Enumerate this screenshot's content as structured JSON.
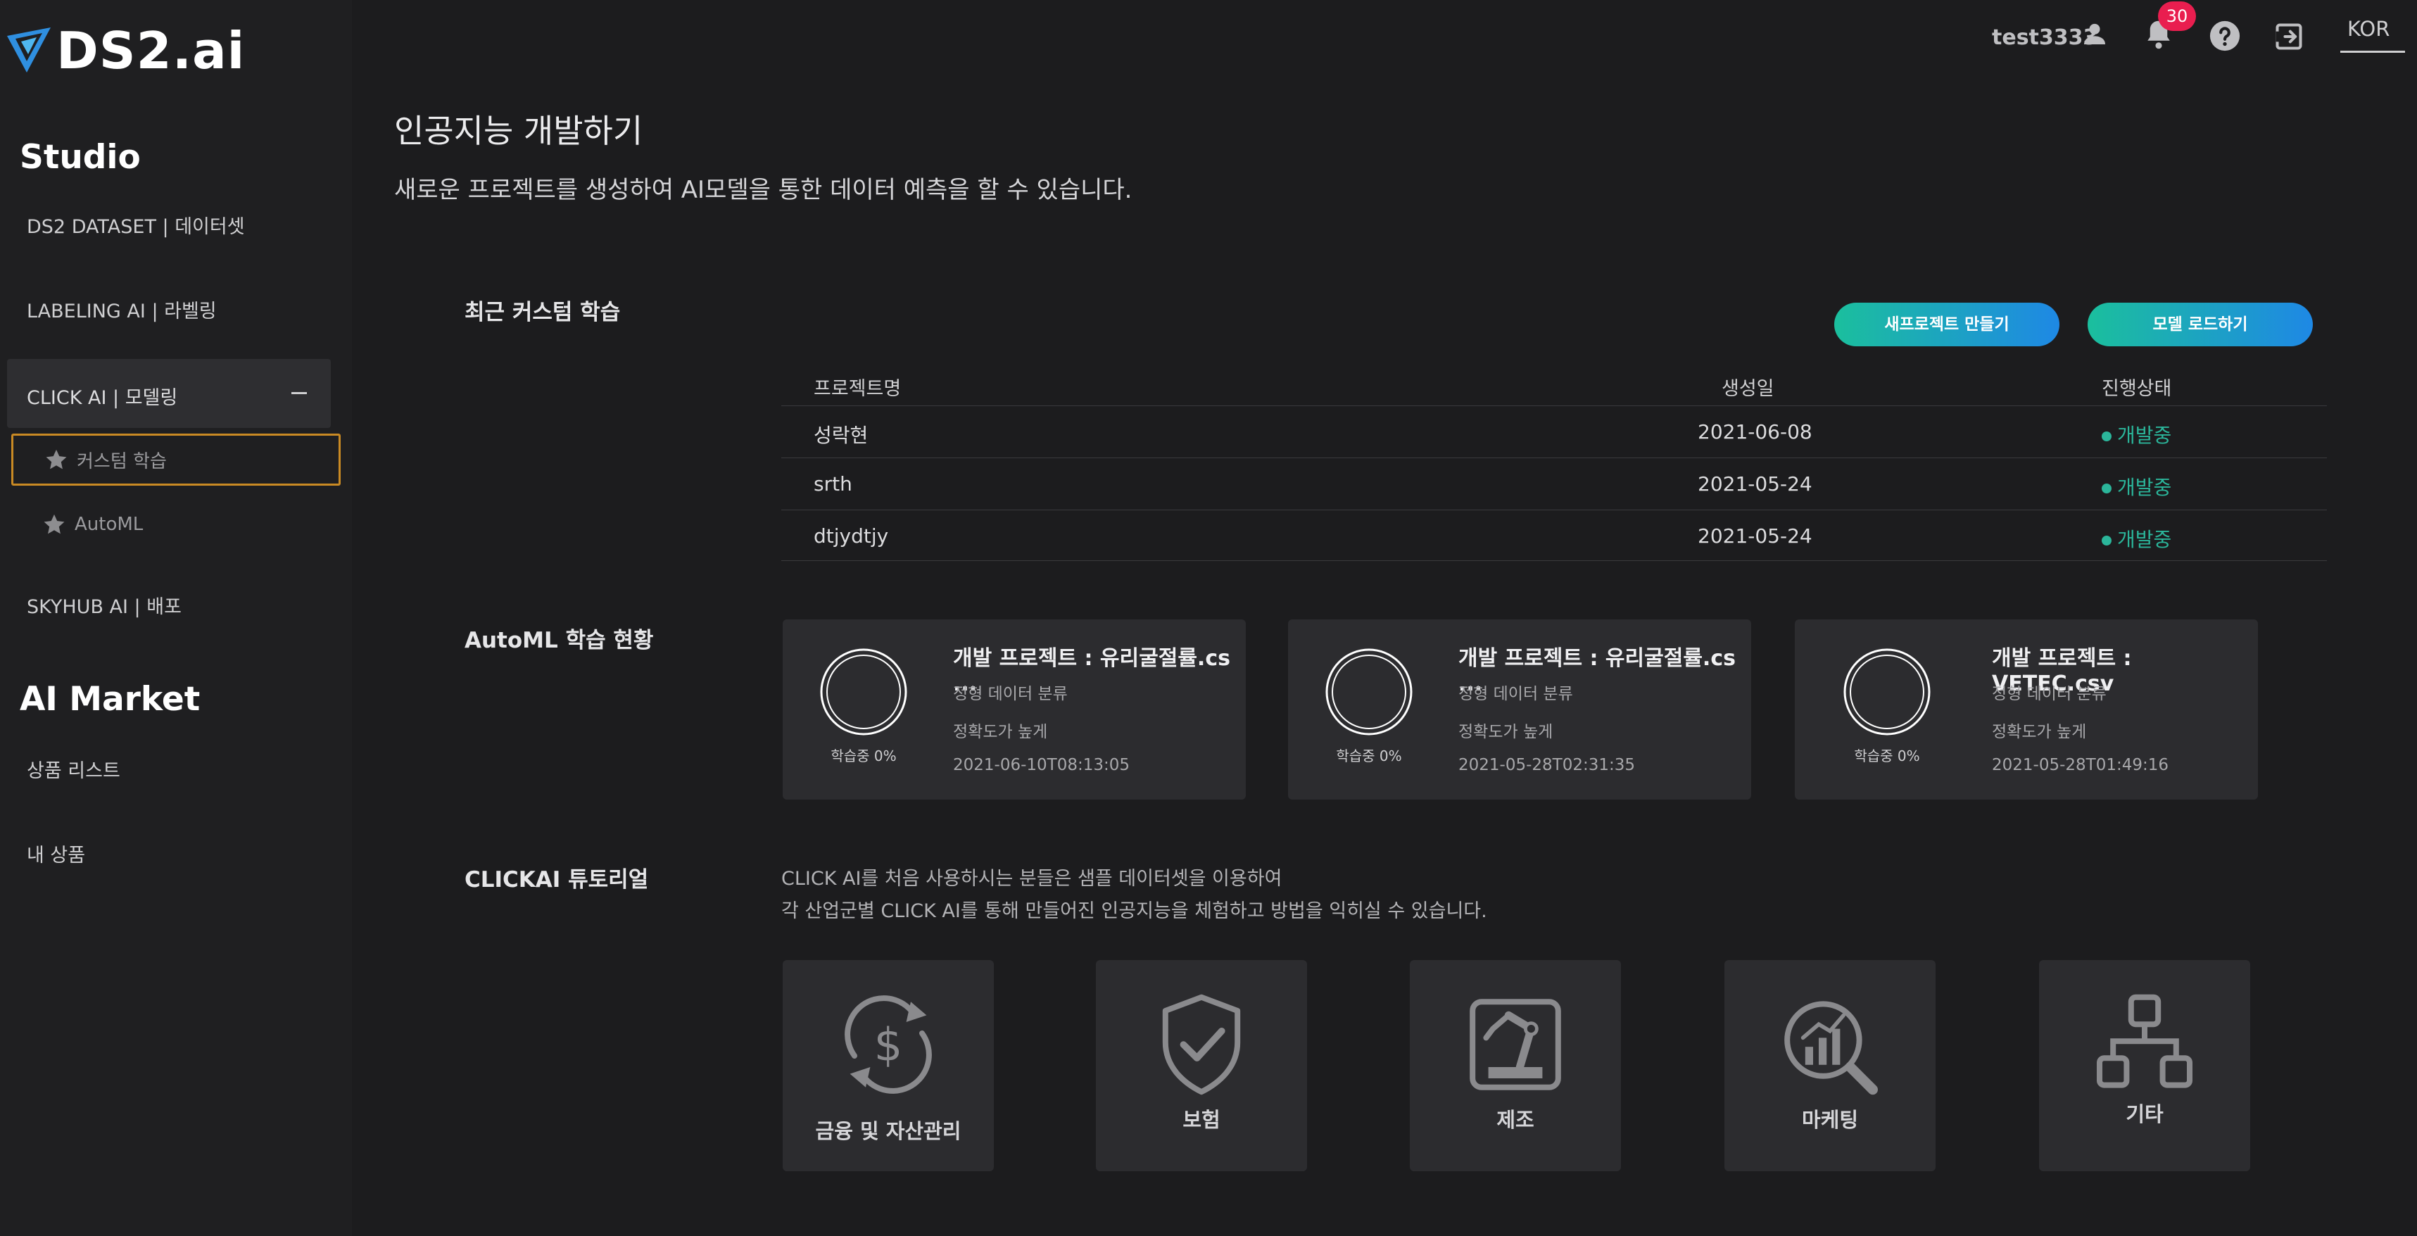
{
  "brand": {
    "name": "DS2.ai"
  },
  "sidebar": {
    "studio_title": "Studio",
    "items": [
      {
        "label": "DS2 DATASET | 데이터셋"
      },
      {
        "label": "LABELING AI | 라벨링"
      },
      {
        "label": "CLICK AI | 모델링"
      },
      {
        "label": "SKYHUB AI | 배포"
      }
    ],
    "sub_items": [
      {
        "label": "커스텀 학습",
        "icon": "star-icon"
      },
      {
        "label": "AutoML",
        "icon": "star-icon"
      }
    ],
    "market_title": "AI Market",
    "market_items": [
      {
        "label": "상품 리스트"
      },
      {
        "label": "내 상품"
      }
    ]
  },
  "header": {
    "username": "test3333",
    "notification_count": "30",
    "language": "KOR"
  },
  "main": {
    "title": "인공지능 개발하기",
    "description": "새로운 프로젝트를 생성하여 AI모델을 통한 데이터 예측을 할 수 있습니다.",
    "recent": {
      "label": "최근 커스텀 학습",
      "new_project_button": "새프로젝트 만들기",
      "load_model_button": "모델 로드하기",
      "columns": [
        "프로젝트명",
        "생성일",
        "진행상태"
      ],
      "rows": [
        {
          "name": "성락현",
          "date": "2021-06-08",
          "status": "개발중"
        },
        {
          "name": "srth",
          "date": "2021-05-24",
          "status": "개발중"
        },
        {
          "name": "dtjydtjy",
          "date": "2021-05-24",
          "status": "개발중"
        }
      ]
    },
    "automl": {
      "label": "AutoML 학습 현황",
      "cards": [
        {
          "title": "개발 프로젝트 : 유리굴절률.cs ...",
          "type": "정형 데이터 분류",
          "goal": "정확도가 높게",
          "timestamp": "2021-06-10T08:13:05",
          "progress_label": "학습중 0%",
          "progress": 0
        },
        {
          "title": "개발 프로젝트 : 유리굴절률.cs ...",
          "type": "정형 데이터 분류",
          "goal": "정확도가 높게",
          "timestamp": "2021-05-28T02:31:35",
          "progress_label": "학습중 0%",
          "progress": 0
        },
        {
          "title": "개발 프로젝트 : VETEC.csv",
          "type": "정형 데이터 분류",
          "goal": "정확도가 높게",
          "timestamp": "2021-05-28T01:49:16",
          "progress_label": "학습중 0%",
          "progress": 0
        }
      ]
    },
    "tutorial": {
      "label": "CLICKAI 튜토리얼",
      "desc_line1": "CLICK AI를 처음 사용하시는 분들은 샘플 데이터셋을 이용하여",
      "desc_line2": "각 산업군별 CLICK AI를 통해 만들어진 인공지능을 체험하고 방법을 익히실 수 있습니다.",
      "tiles": [
        {
          "label": "금융 및 자산관리",
          "icon": "dollar-cycle-icon"
        },
        {
          "label": "보험",
          "icon": "shield-check-icon"
        },
        {
          "label": "제조",
          "icon": "robot-arm-icon"
        },
        {
          "label": "마케팅",
          "icon": "chart-magnifier-icon"
        },
        {
          "label": "기타",
          "icon": "hierarchy-icon"
        }
      ]
    }
  },
  "colors": {
    "accent_teal": "#2bb59a",
    "button_gradient_start": "#1bbf9d",
    "button_gradient_end": "#1e88e5",
    "badge": "#e91e4f",
    "selected_outline": "#c98a24"
  }
}
